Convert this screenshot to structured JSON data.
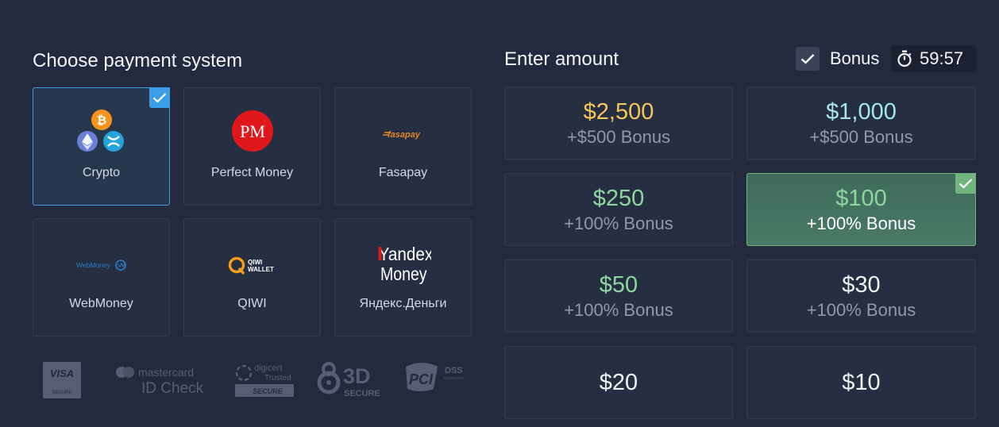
{
  "payment": {
    "title": "Choose payment system",
    "methods": [
      {
        "label": "Crypto",
        "selected": true
      },
      {
        "label": "Perfect Money",
        "logo_text": "PM"
      },
      {
        "label": "Fasapay",
        "logo_text": "fasapay"
      },
      {
        "label": "WebMoney",
        "logo_text": "WebMoney"
      },
      {
        "label": "QIWI",
        "logo_text_1": "QIWI",
        "logo_text_2": "WALLET"
      },
      {
        "label": "Яндекс.Деньги",
        "logo_text_1": "Yandex",
        "logo_text_2": "Money"
      }
    ],
    "badges": {
      "visa": "VISA",
      "visa_sub": "SECURE",
      "mastercard": "mastercard",
      "mastercard_sub": "ID Check",
      "digicert": "digicert",
      "digicert_sub": "Trusted",
      "digicert_secure": "SECURE",
      "threed": "3D",
      "threed_sub": "SECURE",
      "pci": "PCI",
      "dss": "DSS",
      "dss_sub": "COMPLIANT"
    }
  },
  "amount": {
    "title": "Enter amount",
    "bonus_label": "Bonus",
    "bonus_checked": true,
    "timer": "59:57",
    "options": [
      {
        "value": "$2,500",
        "bonus": "+$500 Bonus",
        "color": "#f5c65a"
      },
      {
        "value": "$1,000",
        "bonus": "+$500 Bonus",
        "color": "#a5e6f2"
      },
      {
        "value": "$250",
        "bonus": "+100% Bonus",
        "color": "#8ed6a0"
      },
      {
        "value": "$100",
        "bonus": "+100% Bonus",
        "color": "#8ed6a0",
        "selected": true
      },
      {
        "value": "$50",
        "bonus": "+100% Bonus",
        "color": "#8ed6a0"
      },
      {
        "value": "$30",
        "bonus": "+100% Bonus",
        "color": "#f0f2f6"
      },
      {
        "value": "$20",
        "color": "#f0f2f6"
      },
      {
        "value": "$10",
        "color": "#f0f2f6"
      }
    ]
  },
  "colors": {
    "background": "#232a3d",
    "card": "#262e42",
    "accent_blue": "#3d9ee8",
    "accent_green": "#6fb57c"
  }
}
